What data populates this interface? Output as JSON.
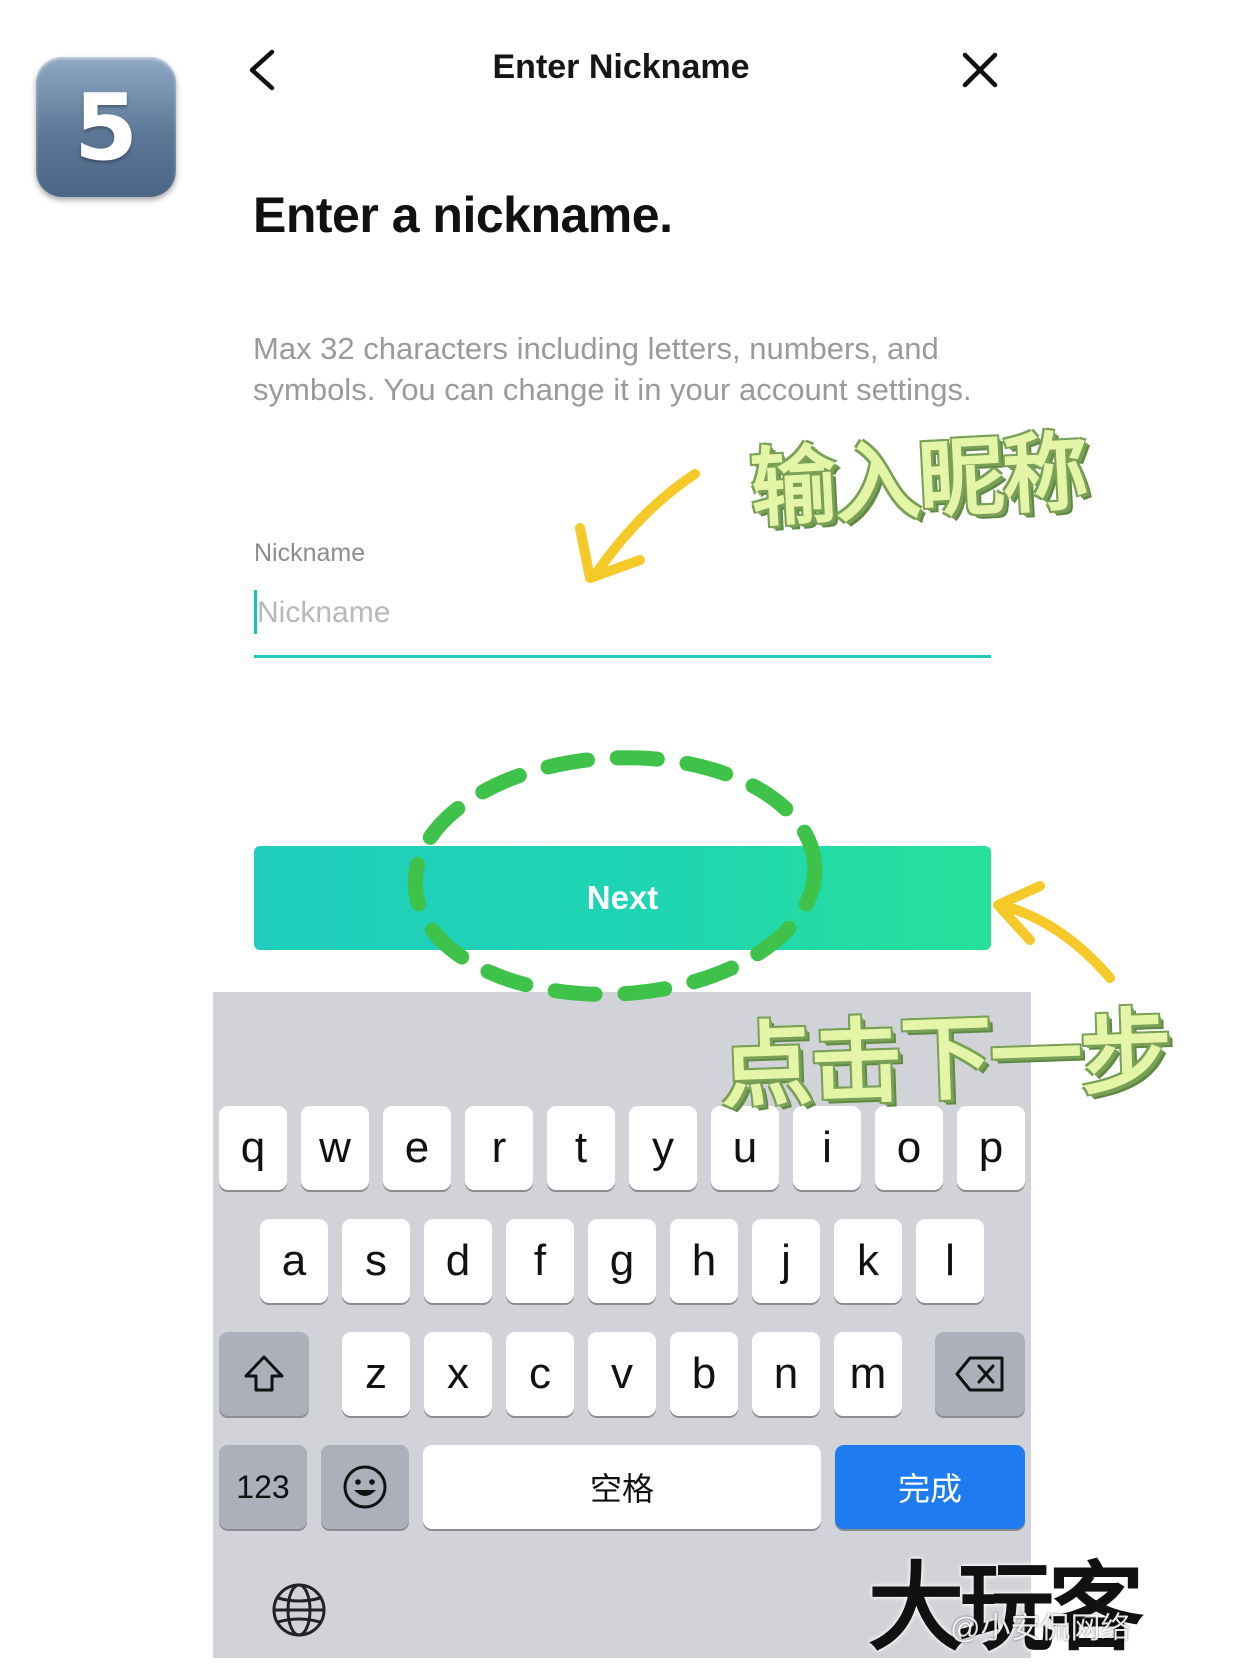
{
  "step_badge": "5",
  "header": {
    "title": "Enter Nickname",
    "back_icon": "chevron-left-icon",
    "close_icon": "close-icon"
  },
  "main": {
    "headline": "Enter a nickname.",
    "helper": "Max 32 characters including letters, numbers, and symbols. You can change it in your account settings.",
    "field_label": "Nickname",
    "input_placeholder": "Nickname",
    "input_value": "",
    "next_label": "Next"
  },
  "annotations": {
    "enter_nickname": "输入昵称",
    "click_next": "点击下一步"
  },
  "keyboard": {
    "row1": [
      "q",
      "w",
      "e",
      "r",
      "t",
      "y",
      "u",
      "i",
      "o",
      "p"
    ],
    "row2": [
      "a",
      "s",
      "d",
      "f",
      "g",
      "h",
      "j",
      "k",
      "l"
    ],
    "row3": [
      "z",
      "x",
      "c",
      "v",
      "b",
      "n",
      "m"
    ],
    "numbers_key": "123",
    "space_key": "空格",
    "done_key": "完成",
    "shift_icon": "shift-icon",
    "backspace_icon": "backspace-icon",
    "emoji_icon": "emoji-icon",
    "globe_icon": "globe-icon"
  },
  "watermark": {
    "main": "大玩客",
    "sub": "@小安侃网络"
  },
  "colors": {
    "accent": "#1fc9c1",
    "button_start": "#20cdbd",
    "button_end": "#27e09a",
    "keyboard_bg": "#d1d3d9",
    "done_key": "#1f7cf0",
    "annotation_fill": "#e4f5a8"
  }
}
